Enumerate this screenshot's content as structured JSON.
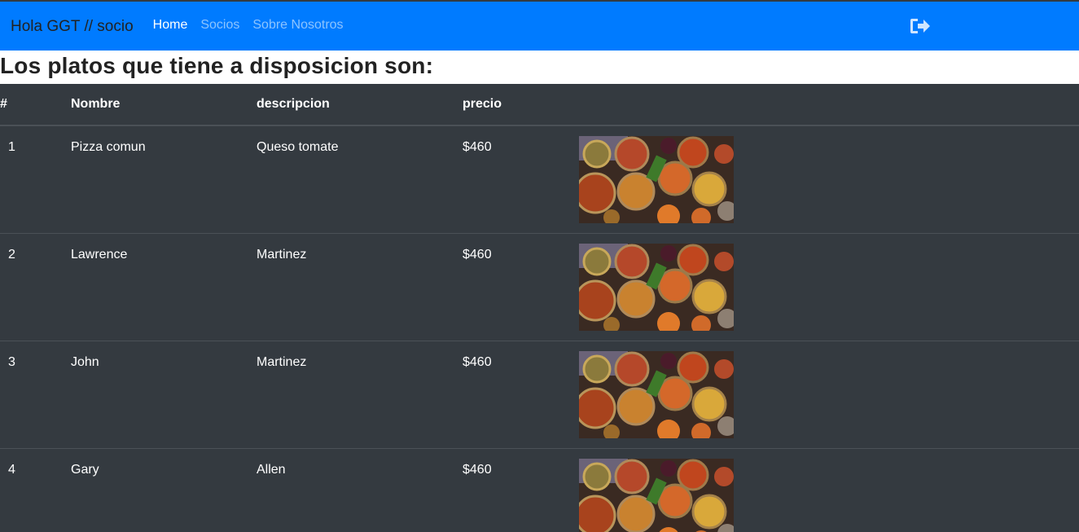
{
  "navbar": {
    "brand": "Hola GGT // socio",
    "links": [
      "Home",
      "Socios",
      "Sobre Nosotros"
    ],
    "active_index": 0,
    "logout_icon": "sign-out-icon",
    "background": "#007bff"
  },
  "heading": "Los platos que tiene a disposicion son:",
  "table": {
    "headers": [
      "#",
      "Nombre",
      "descripcion",
      "precio",
      ""
    ],
    "rows": [
      {
        "num": "1",
        "nombre": "Pizza comun",
        "descripcion": "Queso tomate",
        "precio": "$460",
        "image": "food-platter-image"
      },
      {
        "num": "2",
        "nombre": "Lawrence",
        "descripcion": "Martinez",
        "precio": "$460",
        "image": "food-platter-image"
      },
      {
        "num": "3",
        "nombre": "John",
        "descripcion": "Martinez",
        "precio": "$460",
        "image": "food-platter-image"
      },
      {
        "num": "4",
        "nombre": "Gary",
        "descripcion": "Allen",
        "precio": "$460",
        "image": "food-platter-image"
      }
    ],
    "background": "#343a40"
  }
}
